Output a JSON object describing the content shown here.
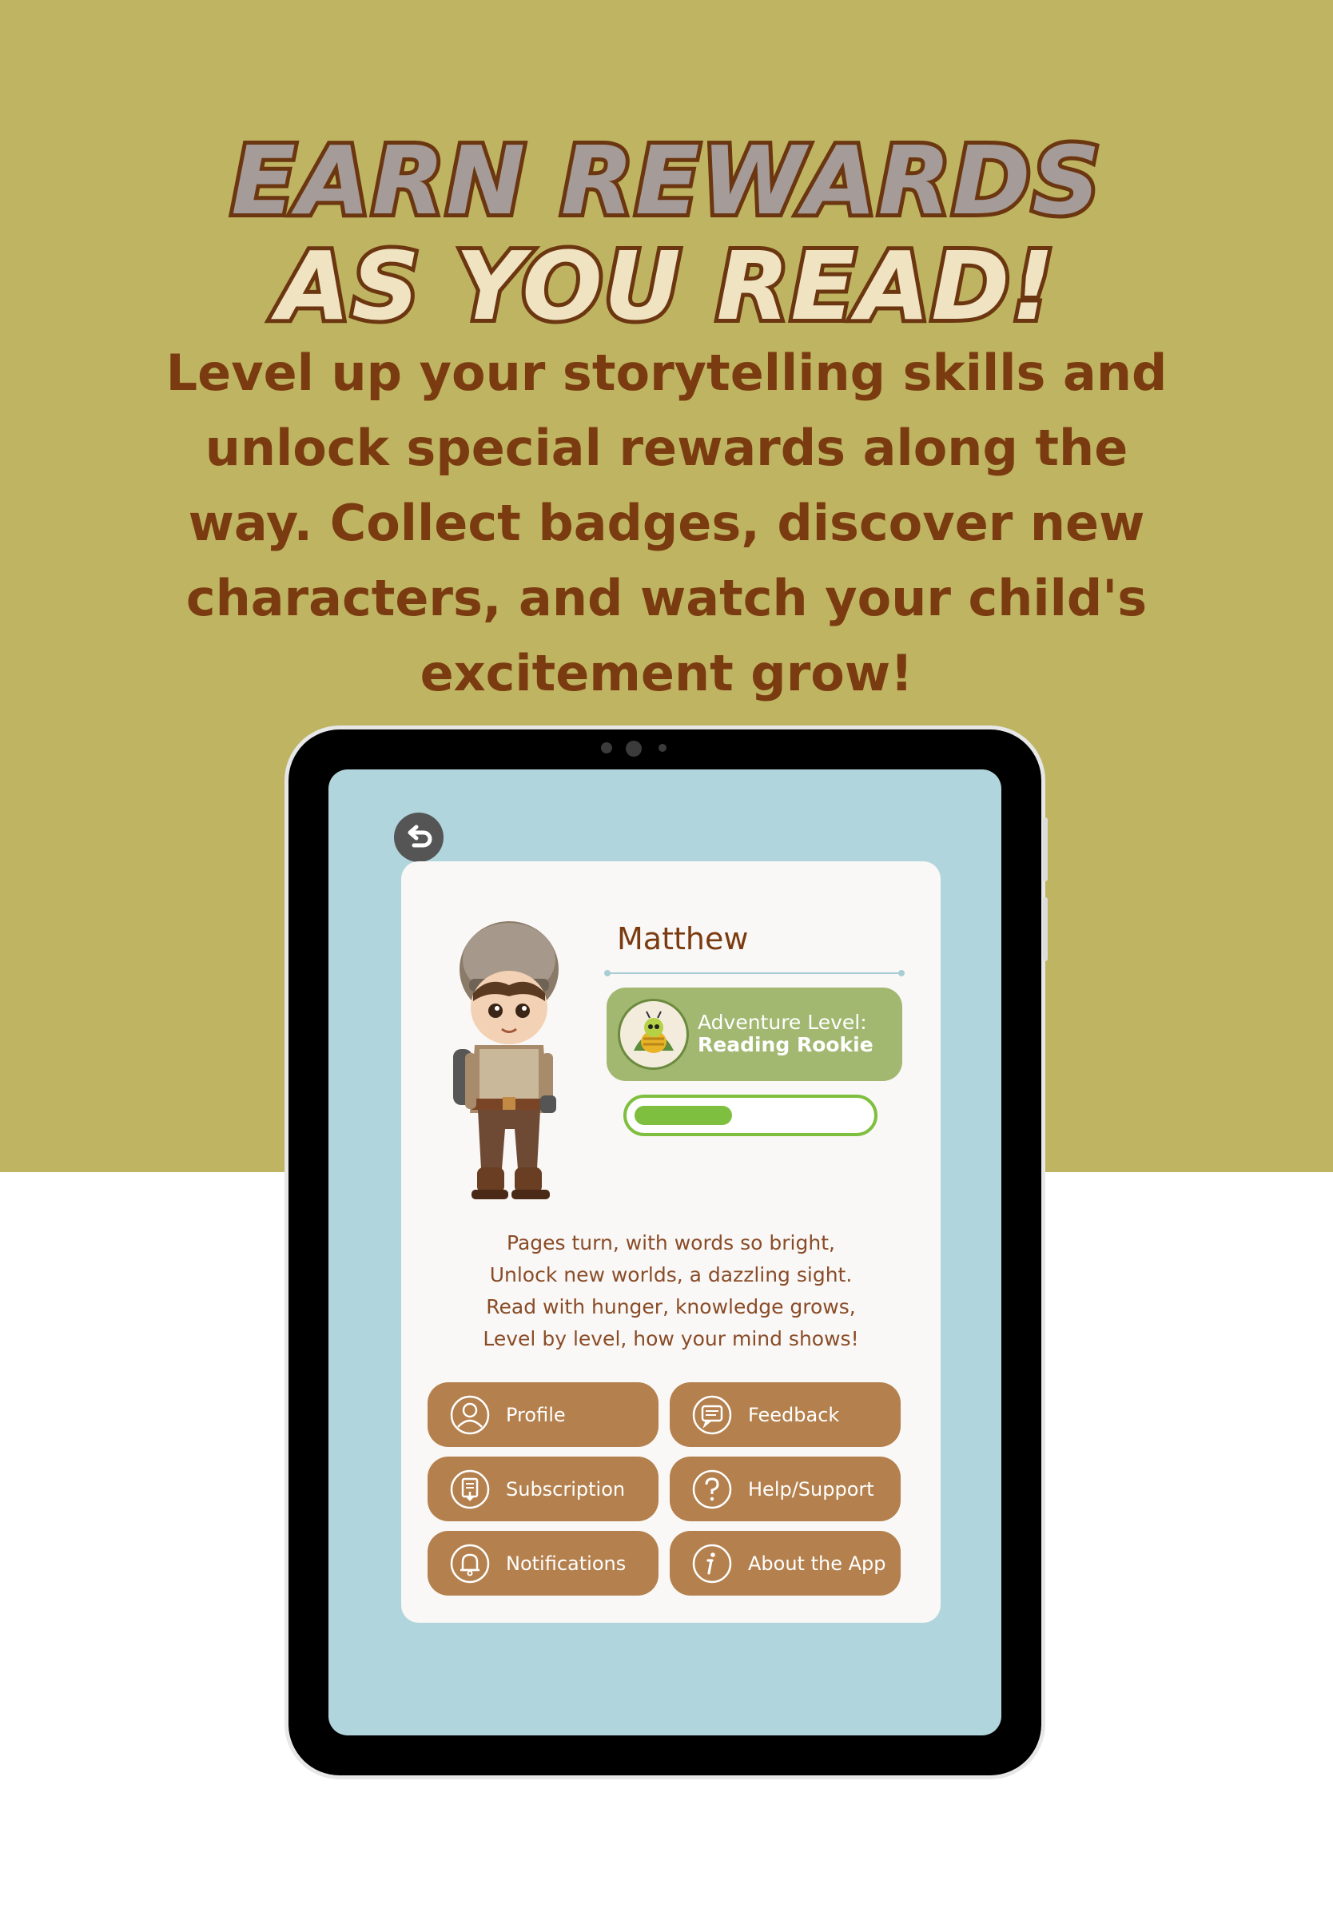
{
  "headline": {
    "line1": "Earn Rewards",
    "line2": "As You Read!"
  },
  "tagline": "Level up your storytelling skills and unlock special rewards along the way. Collect badges, discover new characters, and watch your child's excitement grow!",
  "colors": {
    "background_top": "#beb462",
    "headline_stroke": "#6b3610",
    "tagline": "#7b3b10",
    "screen": "#b1d5dc",
    "level_pill": "#a2b871",
    "progress": "#7ebf3f",
    "menu_button": "#b4804d"
  },
  "profile": {
    "name": "Matthew",
    "level_label": "Adventure Level:",
    "level_name": "Reading Rookie",
    "progress": 0.42
  },
  "poem": [
    "Pages turn, with words so bright,",
    "Unlock new worlds, a dazzling sight.",
    "Read with hunger, knowledge grows,",
    "Level by level, how your mind shows!"
  ],
  "menu": [
    {
      "label": "Profile",
      "icon": "user-icon"
    },
    {
      "label": "Feedback",
      "icon": "chat-icon"
    },
    {
      "label": "Subscription",
      "icon": "subscription-icon"
    },
    {
      "label": "Help/Support",
      "icon": "question-icon"
    },
    {
      "label": "Notifications",
      "icon": "bell-icon"
    },
    {
      "label": "About the App",
      "icon": "info-icon"
    }
  ]
}
